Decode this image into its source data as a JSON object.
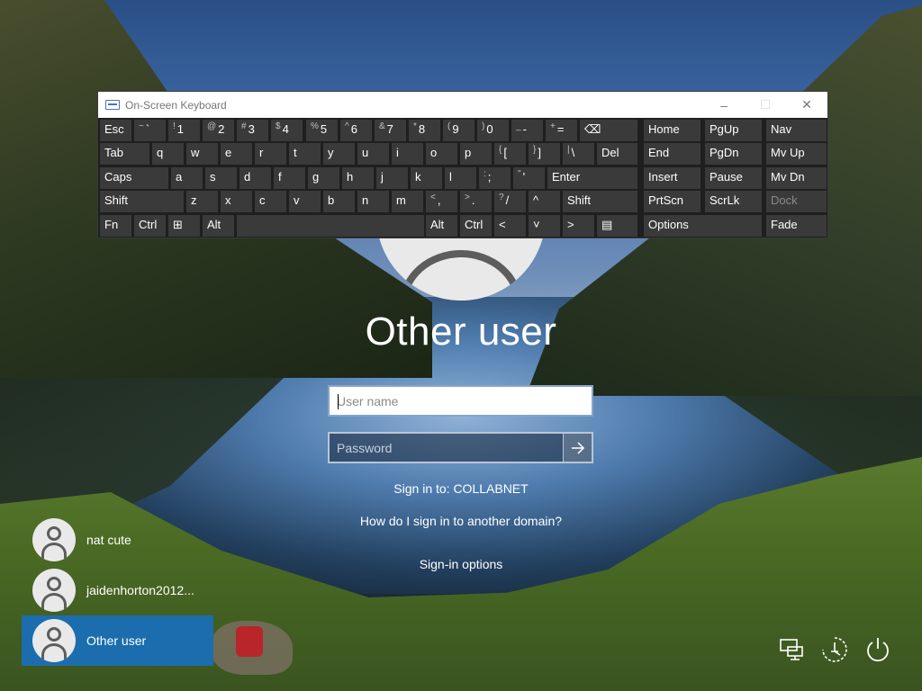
{
  "osk": {
    "title": "On-Screen Keyboard",
    "controls": {
      "minimize": "–",
      "maximize": "☐",
      "close": "✕"
    },
    "rows": [
      [
        {
          "l": "Esc"
        },
        {
          "s": "~",
          "m": "`"
        },
        {
          "s": "!",
          "m": "1"
        },
        {
          "s": "@",
          "m": "2"
        },
        {
          "s": "#",
          "m": "3"
        },
        {
          "s": "$",
          "m": "4"
        },
        {
          "s": "%",
          "m": "5"
        },
        {
          "s": "^",
          "m": "6"
        },
        {
          "s": "&",
          "m": "7"
        },
        {
          "s": "*",
          "m": "8"
        },
        {
          "s": "(",
          "m": "9"
        },
        {
          "s": ")",
          "m": "0"
        },
        {
          "s": "_",
          "m": "-"
        },
        {
          "s": "+",
          "m": "="
        },
        {
          "l": "⌫"
        },
        {
          "l": "Home"
        },
        {
          "l": "PgUp"
        },
        {
          "l": "Nav"
        }
      ],
      [
        {
          "l": "Tab"
        },
        {
          "l": "q"
        },
        {
          "l": "w"
        },
        {
          "l": "e"
        },
        {
          "l": "r"
        },
        {
          "l": "t"
        },
        {
          "l": "y"
        },
        {
          "l": "u"
        },
        {
          "l": "i"
        },
        {
          "l": "o"
        },
        {
          "l": "p"
        },
        {
          "s": "{",
          "m": "["
        },
        {
          "s": "}",
          "m": "]"
        },
        {
          "s": "|",
          "m": "\\"
        },
        {
          "l": "Del"
        },
        {
          "l": "End"
        },
        {
          "l": "PgDn"
        },
        {
          "l": "Mv Up"
        }
      ],
      [
        {
          "l": "Caps"
        },
        {
          "l": "a"
        },
        {
          "l": "s"
        },
        {
          "l": "d"
        },
        {
          "l": "f"
        },
        {
          "l": "g"
        },
        {
          "l": "h"
        },
        {
          "l": "j"
        },
        {
          "l": "k"
        },
        {
          "l": "l"
        },
        {
          "s": ":",
          "m": ";"
        },
        {
          "s": "\"",
          "m": "'"
        },
        {
          "l": "Enter"
        },
        {
          "l": "Insert"
        },
        {
          "l": "Pause"
        },
        {
          "l": "Mv Dn"
        }
      ],
      [
        {
          "l": "Shift"
        },
        {
          "l": "z"
        },
        {
          "l": "x"
        },
        {
          "l": "c"
        },
        {
          "l": "v"
        },
        {
          "l": "b"
        },
        {
          "l": "n"
        },
        {
          "l": "m"
        },
        {
          "s": "<",
          "m": ","
        },
        {
          "s": ">",
          "m": "."
        },
        {
          "s": "?",
          "m": "/"
        },
        {
          "l": "^"
        },
        {
          "l": "Shift"
        },
        {
          "l": "PrtScn"
        },
        {
          "l": "ScrLk"
        },
        {
          "l": "Dock",
          "dim": true
        }
      ],
      [
        {
          "l": "Fn"
        },
        {
          "l": "Ctrl"
        },
        {
          "l": "⊞"
        },
        {
          "l": "Alt"
        },
        {
          "l": ""
        },
        {
          "l": "Alt"
        },
        {
          "l": "Ctrl"
        },
        {
          "l": "<"
        },
        {
          "l": "˅"
        },
        {
          "l": ">"
        },
        {
          "l": "▤"
        },
        {
          "l": "Options"
        },
        {
          "l": "Fade"
        }
      ]
    ]
  },
  "signin": {
    "title": "Other user",
    "username_placeholder": "User name",
    "password_placeholder": "Password",
    "submit_icon": "arrow-right-icon",
    "sign_in_to": "Sign in to: COLLABNET",
    "domain_link": "How do I sign in to another domain?",
    "options_link": "Sign-in options"
  },
  "users": [
    {
      "name": "nat cute",
      "selected": false
    },
    {
      "name": "jaidenhorton2012...",
      "selected": false
    },
    {
      "name": "Other user",
      "selected": true
    }
  ],
  "system_icons": [
    "network-icon",
    "ease-of-access-icon",
    "power-icon"
  ],
  "colors": {
    "selected_user": "#1b6dad",
    "key_bg": "#3a3a3a",
    "keyboard_bg": "#1f1f1f"
  }
}
